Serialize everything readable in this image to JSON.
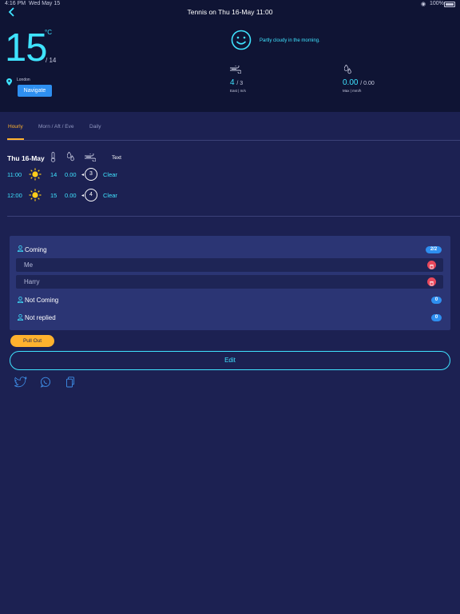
{
  "status_bar": {
    "time": "4:16 PM",
    "date": "Wed May 15",
    "battery": "100%"
  },
  "header": {
    "title": "Tennis on Thu 16-May 11:00"
  },
  "current": {
    "temperature": "15",
    "unit": "°C",
    "low": "/ 14",
    "location": "London",
    "navigate_label": "Navigate",
    "description": "Partly cloudy in the morning.",
    "wind_speed": "4",
    "wind_gust": "/ 3",
    "wind_sub": "East | m/s",
    "rain": "0.00",
    "rain_max": "/ 0.00",
    "rain_sub": "Max | mm/h"
  },
  "tabs": [
    {
      "label": "Hourly",
      "active": true
    },
    {
      "label": "Morn / Aft / Eve",
      "active": false
    },
    {
      "label": "Daily",
      "active": false
    }
  ],
  "hourly": {
    "day": "Thu 16-May",
    "text_header": "Text",
    "rows": [
      {
        "time": "11:00",
        "icon": "sun-icon",
        "temp": "14",
        "rain": "0.00",
        "wind": "3",
        "text": "Clear"
      },
      {
        "time": "12:00",
        "icon": "sun-icon",
        "temp": "15",
        "rain": "0.00",
        "wind": "4",
        "text": "Clear"
      }
    ]
  },
  "attendance": {
    "coming": {
      "label": "Coming",
      "count": "2/2",
      "members": [
        "Me",
        "Harry"
      ]
    },
    "not_coming": {
      "label": "Not Coming",
      "count": "0"
    },
    "not_replied": {
      "label": "Not replied",
      "count": "0"
    }
  },
  "actions": {
    "pull_out_label": "Pull Out",
    "edit_label": "Edit"
  },
  "share": [
    "twitter-icon",
    "whatsapp-icon",
    "copy-icon"
  ],
  "colors": {
    "accent": "#3fe3ff",
    "warning": "#ffb22e",
    "primary": "#2e8ff0",
    "danger": "#e8485c",
    "background": "#1c2152"
  }
}
